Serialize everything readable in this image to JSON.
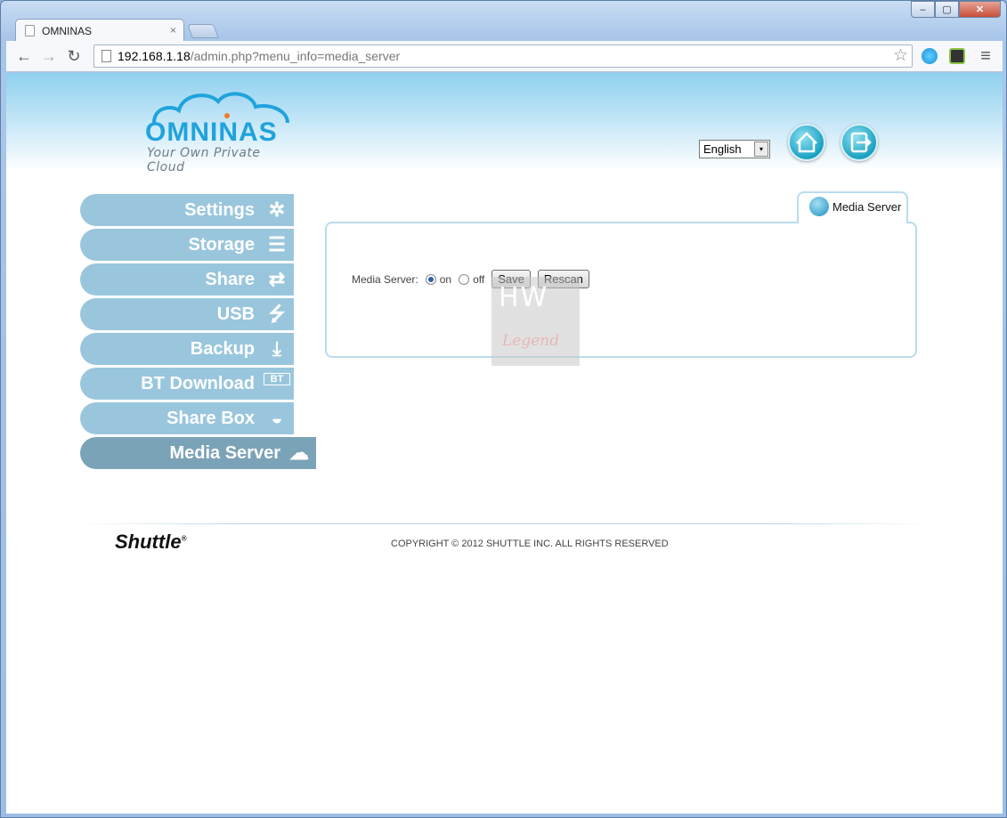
{
  "browser": {
    "tab_title": "OMNINAS",
    "tab_close": "×",
    "url_host": "192.168.1.18",
    "url_path": "/admin.php?menu_info=media_server",
    "back": "←",
    "forward": "→",
    "reload": "↻",
    "star": "☆",
    "menu": "≡",
    "win_minimize": "–",
    "win_maximize": "▢",
    "win_close": "✕"
  },
  "header": {
    "logo_name": "OMNINAS",
    "logo_tagline": "Your Own Private Cloud",
    "language": "English",
    "language_arrow": "▾",
    "home_icon": "⌂",
    "logout_icon": "⇥"
  },
  "sidebar": {
    "items": [
      {
        "label": "Settings",
        "icon": "✲"
      },
      {
        "label": "Storage",
        "icon": "☰"
      },
      {
        "label": "Share",
        "icon": "⇄"
      },
      {
        "label": "USB",
        "icon": "⭍"
      },
      {
        "label": "Backup",
        "icon": "⤓"
      },
      {
        "label": "BT Download",
        "icon": "BT"
      },
      {
        "label": "Share Box",
        "icon": "◒"
      },
      {
        "label": "Media Server",
        "icon": "☁"
      }
    ],
    "active_index": 7
  },
  "panel": {
    "tab_label": "Media Server",
    "field_label": "Media Server:",
    "option_on": "on",
    "option_off": "off",
    "selected": "on",
    "save_button": "Save",
    "rescan_button": "Rescan"
  },
  "watermark": {
    "top": "HW",
    "bottom": "Legend"
  },
  "footer": {
    "brand": "Shuttle",
    "brand_mark": "®",
    "copyright": "COPYRIGHT © 2012 SHUTTLE INC. ALL RIGHTS RESERVED"
  }
}
